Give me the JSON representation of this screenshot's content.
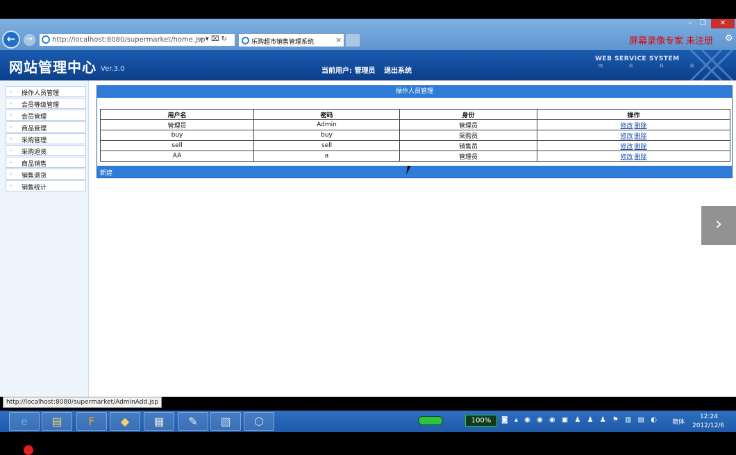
{
  "browser": {
    "url": "http://localhost:8080/supermarket/home.jsp",
    "address_tools": "⌕ ▾ ⌧ ↻",
    "tab_title": "乐购超市销售管理系统",
    "tab_close": "×",
    "window_min": "–",
    "window_max": "❐",
    "window_close": "✕",
    "watermark": "屏幕录像专家  未注册",
    "status_url": "http://localhost:8080/supermarket/AdminAdd.jsp"
  },
  "header": {
    "title": "网站管理中心",
    "version": "Ver.3.0",
    "current_user": "当前用户: 管理员",
    "logout": "退出系统",
    "ws_title": "WEB SERVICE SYSTEM",
    "ws_sub": "网 站 科 技"
  },
  "sidebar": {
    "items": [
      {
        "label": "操作人员管理"
      },
      {
        "label": "会员等级管理"
      },
      {
        "label": "会员管理"
      },
      {
        "label": "商品管理"
      },
      {
        "label": "采购管理"
      },
      {
        "label": "采购退货"
      },
      {
        "label": "商品销售"
      },
      {
        "label": "销售退货"
      },
      {
        "label": "销售统计"
      }
    ]
  },
  "panel": {
    "title": "操作人员管理",
    "columns": [
      "用户名",
      "密码",
      "身份",
      "操作"
    ],
    "rows": [
      {
        "username": "管理员",
        "password": "Admin",
        "role": "管理员",
        "edit": "修改",
        "delete": "删除"
      },
      {
        "username": "buy",
        "password": "buy",
        "role": "采购员",
        "edit": "修改",
        "delete": "删除"
      },
      {
        "username": "sell",
        "password": "sell",
        "role": "销售员",
        "edit": "修改",
        "delete": "删除"
      },
      {
        "username": "AA",
        "password": "a",
        "role": "管理员",
        "edit": "修改",
        "delete": "删除"
      }
    ],
    "new_link": "新建"
  },
  "taskbar": {
    "apps": [
      "internet-explorer-icon",
      "file-explorer-icon",
      "flashget-icon",
      "folder-icon",
      "image-viewer-icon",
      "notepad-icon",
      "photo-editor-icon",
      "virtualbox-icon"
    ],
    "zoom": "100%",
    "tray_icons": "◙ ▴ ◉ ◉ ◉ ▣ ♟ ♟ ♟ ⚑ ▥ ▤ ◐",
    "ime": "简体",
    "time": "12:24",
    "date": "2012/12/6"
  },
  "colors": {
    "header_bg": "#0c3f8a",
    "panel_bar": "#2f7bd8",
    "watermark": "#e00000",
    "taskbar": "#1f5aa8"
  }
}
